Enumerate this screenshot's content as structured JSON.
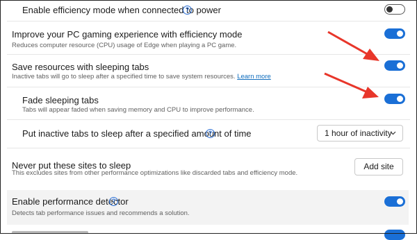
{
  "settings": {
    "efficiency_power": {
      "label": "Enable efficiency mode when connected to power",
      "help": "?",
      "enabled": false
    },
    "gaming": {
      "label": "Improve your PC gaming experience with efficiency mode",
      "desc": "Reduces computer resource (CPU) usage of Edge when playing a PC game.",
      "enabled": true
    },
    "sleeping_tabs": {
      "label": "Save resources with sleeping tabs",
      "desc": "Inactive tabs will go to sleep after a specified time to save system resources.",
      "link": "Learn more",
      "enabled": true
    },
    "fade": {
      "label": "Fade sleeping tabs",
      "desc": "Tabs will appear faded when saving memory and CPU to improve performance.",
      "enabled": true
    },
    "inactive_time": {
      "label": "Put inactive tabs to sleep after a specified amount of time",
      "help": "?",
      "selected": "1 hour of inactivity",
      "chevron": "chevron-down-icon"
    },
    "never_sleep": {
      "label": "Never put these sites to sleep",
      "desc": "This excludes sites from other performance optimizations like discarded tabs and efficiency mode.",
      "button": "Add site"
    },
    "perf_detector": {
      "label": "Enable performance detector",
      "help": "?",
      "desc": "Detects tab performance issues and recommends a solution.",
      "enabled": true
    }
  },
  "colors": {
    "toggle_on": "#1a6fd6",
    "arrow": "#e8362a",
    "link": "#0f6cbd"
  }
}
